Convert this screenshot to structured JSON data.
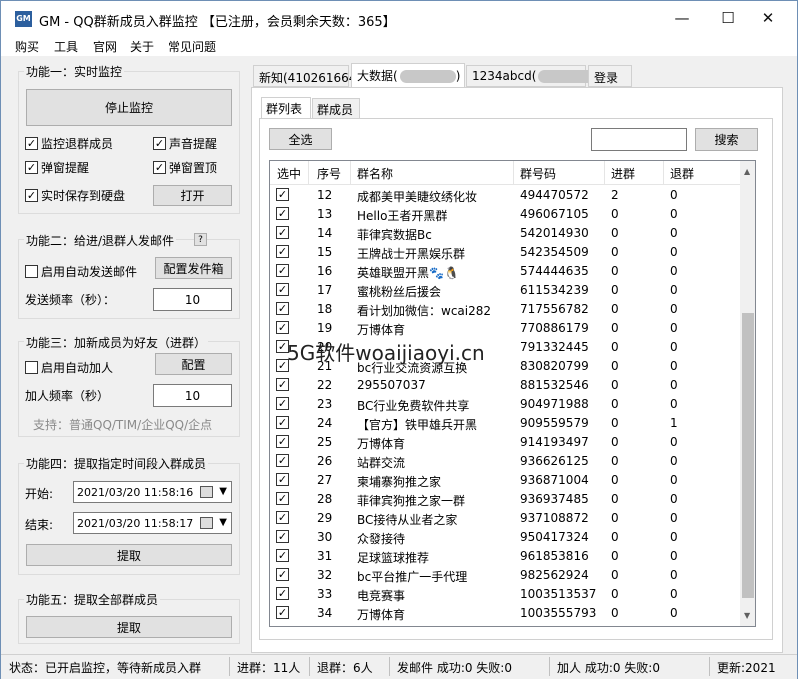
{
  "window": {
    "app_icon_text": "GM",
    "title": "GM - QQ群新成员入群监控 【已注册，会员剩余天数：365】",
    "controls": {
      "minimize": "—",
      "maximize": "☐",
      "close": "✕"
    }
  },
  "menu": [
    "购买",
    "工具",
    "官网",
    "关于",
    "常见问题"
  ],
  "func1": {
    "title": "功能一：实时监控",
    "stop_button": "停止监控",
    "options": [
      {
        "label": "监控退群成员",
        "checked": true
      },
      {
        "label": "声音提醒",
        "checked": true
      },
      {
        "label": "弹窗提醒",
        "checked": true
      },
      {
        "label": "弹窗置顶",
        "checked": true
      },
      {
        "label": "实时保存到硬盘",
        "checked": true
      }
    ],
    "open_button": "打开"
  },
  "func2": {
    "title": "功能二：给进/退群人发邮件",
    "help": "?",
    "auto_send": {
      "label": "启用自动发送邮件",
      "checked": false
    },
    "config_button": "配置发件箱",
    "freq_label": "发送频率（秒）：",
    "freq_value": "10"
  },
  "func3": {
    "title": "功能三：加新成员为好友（进群）",
    "auto_add": {
      "label": "启用自动加人",
      "checked": false
    },
    "config_button": "配置",
    "freq_label": "加人频率（秒）",
    "freq_value": "10",
    "support_text": "支持：普通QQ/TIM/企业QQ/企点"
  },
  "func4": {
    "title": "功能四：提取指定时间段入群成员",
    "start_label": "开始:",
    "start_value": "2021/03/20 11:58:16",
    "end_label": "结束:",
    "end_value": "2021/03/20 11:58:17",
    "extract_button": "提取"
  },
  "func5": {
    "title": "功能五：提取全部群成员",
    "extract_button": "提取"
  },
  "tabs": [
    {
      "label": "新知(410261664)",
      "active": false
    },
    {
      "label": "大数据(",
      "suffix": ")",
      "active": true
    },
    {
      "label": "1234abcd(",
      "suffix": ")",
      "active": false
    },
    {
      "label": "登录",
      "active": false
    }
  ],
  "inner_tabs": [
    {
      "label": "群列表",
      "active": true
    },
    {
      "label": "群成员",
      "active": false
    }
  ],
  "select_all_button": "全选",
  "search": {
    "value": "",
    "button": "搜索"
  },
  "table": {
    "headers": [
      "选中",
      "序号",
      "群名称",
      "群号码",
      "进群",
      "退群"
    ],
    "rows": [
      {
        "checked": true,
        "no": "12",
        "name": "成都美甲美睫纹绣化妆",
        "id": "494470572",
        "join": "2",
        "quit": "0"
      },
      {
        "checked": true,
        "no": "13",
        "name": "Hello王者开黑群",
        "id": "496067105",
        "join": "0",
        "quit": "0"
      },
      {
        "checked": true,
        "no": "14",
        "name": "菲律宾数据Bc",
        "id": "542014930",
        "join": "0",
        "quit": "0"
      },
      {
        "checked": true,
        "no": "15",
        "name": "王牌战士开黑娱乐群",
        "id": "542354509",
        "join": "0",
        "quit": "0"
      },
      {
        "checked": true,
        "no": "16",
        "name": "英雄联盟开黑🐾🐧",
        "id": "574444635",
        "join": "0",
        "quit": "0"
      },
      {
        "checked": true,
        "no": "17",
        "name": "蜜桃粉丝后援会",
        "id": "611534239",
        "join": "0",
        "quit": "0"
      },
      {
        "checked": true,
        "no": "18",
        "name": "看计划加微信：wcai282",
        "id": "717556782",
        "join": "0",
        "quit": "0"
      },
      {
        "checked": true,
        "no": "19",
        "name": "万博体育",
        "id": "770886179",
        "join": "0",
        "quit": "0"
      },
      {
        "checked": true,
        "no": "20",
        "name": "",
        "id": "791332445",
        "join": "0",
        "quit": "0"
      },
      {
        "checked": true,
        "no": "21",
        "name": "bc行业交流资源互换",
        "id": "830820799",
        "join": "0",
        "quit": "0"
      },
      {
        "checked": true,
        "no": "22",
        "name": "295507037",
        "id": "881532546",
        "join": "0",
        "quit": "0"
      },
      {
        "checked": true,
        "no": "23",
        "name": "BC行业免费软件共享",
        "id": "904971988",
        "join": "0",
        "quit": "0"
      },
      {
        "checked": true,
        "no": "24",
        "name": "【官方】铁甲雄兵开黑",
        "id": "909559579",
        "join": "0",
        "quit": "1"
      },
      {
        "checked": true,
        "no": "25",
        "name": "万博体育",
        "id": "914193497",
        "join": "0",
        "quit": "0"
      },
      {
        "checked": true,
        "no": "26",
        "name": "站群交流",
        "id": "936626125",
        "join": "0",
        "quit": "0"
      },
      {
        "checked": true,
        "no": "27",
        "name": "柬埔寨狗推之家",
        "id": "936871004",
        "join": "0",
        "quit": "0"
      },
      {
        "checked": true,
        "no": "28",
        "name": "菲律宾狗推之家一群",
        "id": "936937485",
        "join": "0",
        "quit": "0"
      },
      {
        "checked": true,
        "no": "29",
        "name": "BC接待从业者之家",
        "id": "937108872",
        "join": "0",
        "quit": "0"
      },
      {
        "checked": true,
        "no": "30",
        "name": "众發接待",
        "id": "950417324",
        "join": "0",
        "quit": "0"
      },
      {
        "checked": true,
        "no": "31",
        "name": "足球篮球推荐",
        "id": "961853816",
        "join": "0",
        "quit": "0"
      },
      {
        "checked": true,
        "no": "32",
        "name": "bc平台推广一手代理",
        "id": "982562924",
        "join": "0",
        "quit": "0"
      },
      {
        "checked": true,
        "no": "33",
        "name": "电竞赛事",
        "id": "1003513537",
        "join": "0",
        "quit": "0"
      },
      {
        "checked": true,
        "no": "34",
        "name": "万博体育",
        "id": "1003555793",
        "join": "0",
        "quit": "0"
      }
    ]
  },
  "watermark": "5G软件woaijiaoyi.cn",
  "status": {
    "state": "状态：已开启监控，等待新成员入群",
    "joined": "进群：11人",
    "quit": "退群：6人",
    "mail": "发邮件 成功:0 失败:0",
    "add": "加人 成功:0 失败:0",
    "update": "更新:2021"
  },
  "colors": {
    "accent": "#2c5f9e",
    "selected_blue": "#0078d7"
  }
}
